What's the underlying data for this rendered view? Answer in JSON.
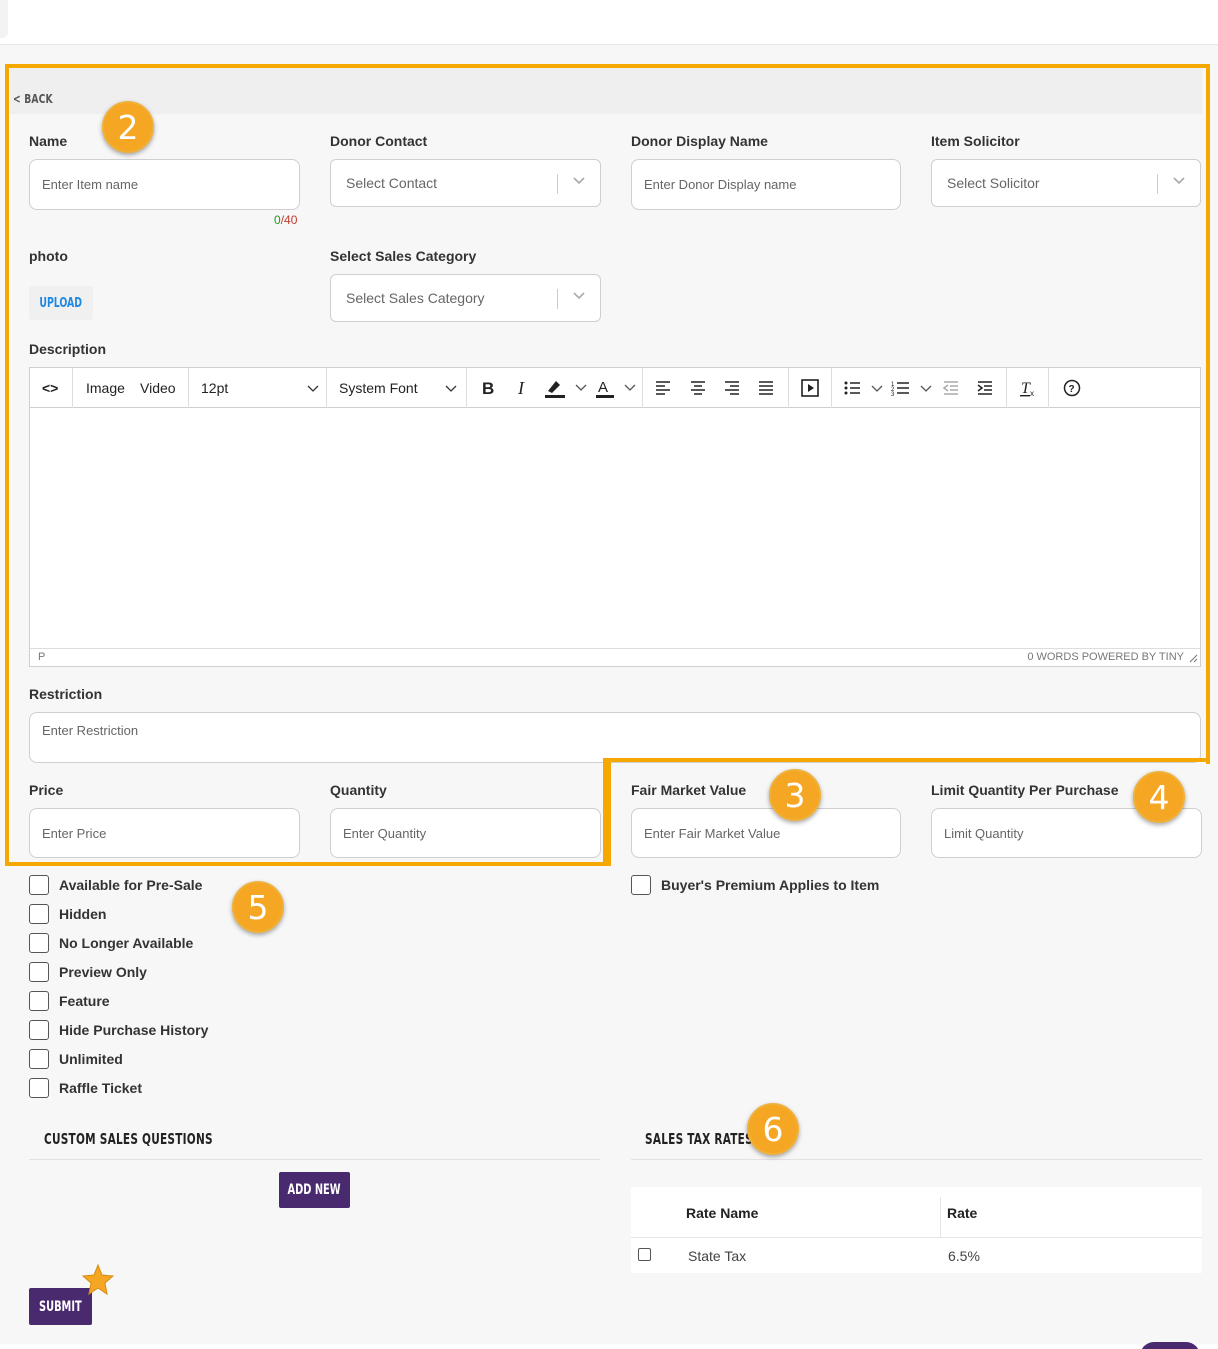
{
  "nav": {
    "back_label": "< BACK"
  },
  "form": {
    "name": {
      "label": "Name",
      "placeholder": "Enter Item name",
      "count": "0",
      "max": "/40"
    },
    "donor_contact": {
      "label": "Donor Contact",
      "placeholder": "Select Contact"
    },
    "donor_display": {
      "label": "Donor Display Name",
      "placeholder": "Enter Donor Display name"
    },
    "solicitor": {
      "label": "Item Solicitor",
      "placeholder": "Select Solicitor"
    },
    "photo": {
      "label": "photo",
      "upload_label": "UPLOAD"
    },
    "sales_category": {
      "label": "Select Sales Category",
      "placeholder": "Select Sales Category"
    },
    "description": {
      "label": "Description"
    },
    "restriction": {
      "label": "Restriction",
      "placeholder": "Enter Restriction"
    },
    "price": {
      "label": "Price",
      "placeholder": "Enter Price"
    },
    "quantity": {
      "label": "Quantity",
      "placeholder": "Enter Quantity"
    },
    "fair_market": {
      "label": "Fair Market Value",
      "placeholder": "Enter Fair Market Value"
    },
    "limit_qty": {
      "label": "Limit Quantity Per Purchase",
      "placeholder": "Limit Quantity"
    }
  },
  "editor": {
    "code_icon": "<>",
    "image_label": "Image",
    "video_label": "Video",
    "font_size": "12pt",
    "font_family": "System Font",
    "status_left": "P",
    "status_right": "0 WORDS  POWERED BY TINY"
  },
  "checkboxes_left": [
    "Available for Pre-Sale",
    "Hidden",
    "No Longer Available",
    "Preview Only",
    "Feature",
    "Hide Purchase History",
    "Unlimited",
    "Raffle Ticket"
  ],
  "checkbox_right": "Buyer's Premium Applies to Item",
  "custom_questions": {
    "title": "CUSTOM SALES QUESTIONS",
    "add_label": "ADD NEW"
  },
  "sales_tax": {
    "title": "SALES TAX RATES",
    "columns": [
      "Rate Name",
      "Rate"
    ],
    "rows": [
      {
        "name": "State Tax",
        "rate": "6.5%"
      }
    ]
  },
  "submit_label": "SUBMIT",
  "annotations": [
    "2",
    "3",
    "4",
    "5",
    "6"
  ],
  "colors": {
    "accent_purple": "#4a2a6f",
    "annotation_orange": "#f5a800",
    "link_blue": "#1e88e5"
  }
}
